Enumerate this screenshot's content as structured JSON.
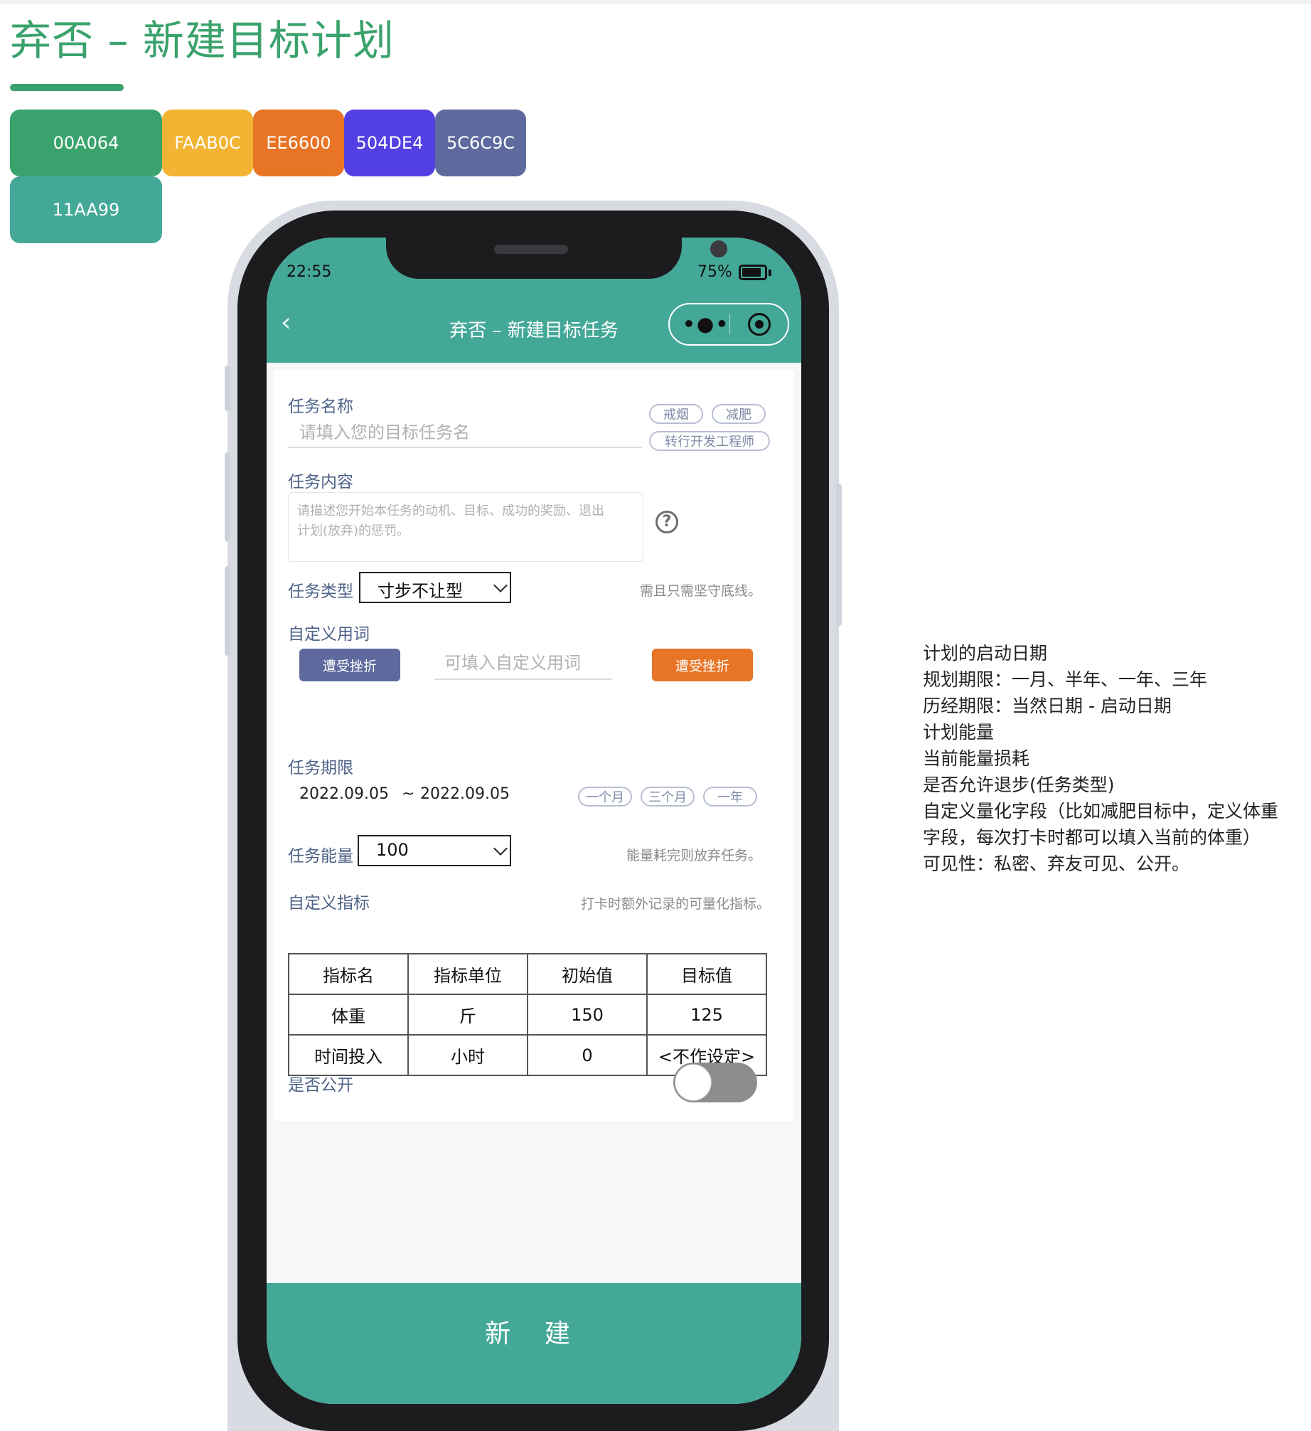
{
  "page_title": "弃否 – 新建目标计划",
  "swatches": [
    {
      "label": "00A064",
      "color": "#3aa26c"
    },
    {
      "label": "FAAB0C",
      "color": "#f2b432"
    },
    {
      "label": "EE6600",
      "color": "#e87425"
    },
    {
      "label": "504DE4",
      "color": "#5340e2"
    },
    {
      "label": "5C6C9C",
      "color": "#5e6a9e"
    },
    {
      "label": "11AA99",
      "color": "#44a898"
    }
  ],
  "status_bar": {
    "time": "22:55",
    "battery": "75%",
    "battery_level": 0.75
  },
  "nav": {
    "back_icon": "chevron-left-icon",
    "title": "弃否 – 新建目标任务",
    "more_icon": "more-dots-icon",
    "close_icon": "target-icon"
  },
  "task_name": {
    "label": "任务名称",
    "placeholder": "请填入您的目标任务名",
    "suggestions": [
      "戒烟",
      "减肥",
      "转行开发工程师"
    ]
  },
  "task_content": {
    "label": "任务内容",
    "placeholder_line1": "请描述您开始本任务的动机、目标、成功的奖励、退出",
    "placeholder_line2": "计划(放弃)的惩罚。",
    "help_icon": "question-circle-icon"
  },
  "task_type": {
    "label": "任务类型",
    "value": "寸步不让型",
    "hint": "需且只需坚守底线。"
  },
  "custom_words": {
    "label": "自定义用词",
    "left_button": "遭受挫折",
    "input_placeholder": "可填入自定义用词",
    "right_button": "遭受挫折"
  },
  "task_period": {
    "label": "任务期限",
    "start": "2022.09.05",
    "separator": "~",
    "end": "2022.09.05",
    "options": [
      "一个月",
      "三个月",
      "一年"
    ]
  },
  "task_energy": {
    "label": "任务能量",
    "value": "100",
    "hint": "能量耗完则放弃任务。"
  },
  "custom_metrics": {
    "label": "自定义指标",
    "hint": "打卡时额外记录的可量化指标。",
    "headers": [
      "指标名",
      "指标单位",
      "初始值",
      "目标值"
    ],
    "rows": [
      [
        "体重",
        "斤",
        "150",
        "125"
      ],
      [
        "时间投入",
        "小时",
        "0",
        "<不作设定>"
      ]
    ]
  },
  "is_public": {
    "label": "是否公开",
    "on": false
  },
  "submit_button": "新  建",
  "notes": [
    "计划的启动日期",
    "规划期限：一月、半年、一年、三年",
    "历经期限：当然日期 - 启动日期",
    "计划能量",
    "当前能量损耗",
    "是否允许退步(任务类型)",
    "自定义量化字段（比如减肥目标中，定义体重",
    "字段，每次打卡时都可以填入当前的体重）",
    "可见性：私密、弃友可见、公开。"
  ]
}
